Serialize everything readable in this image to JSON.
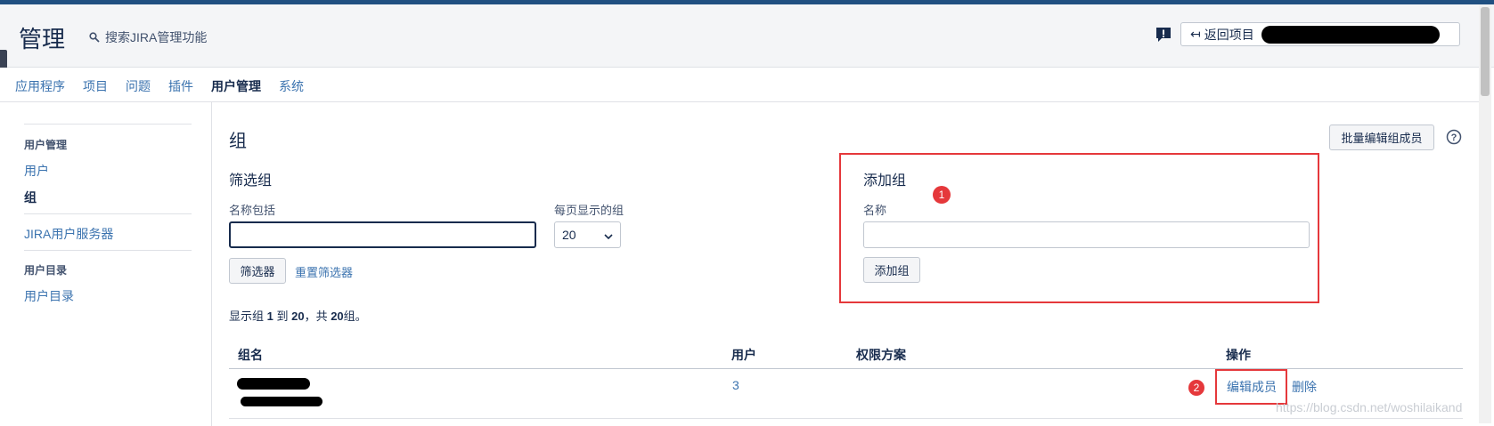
{
  "header": {
    "title": "管理",
    "search_label": "搜索JIRA管理功能",
    "back_label": "返回项目"
  },
  "nav": {
    "items": [
      {
        "label": "应用程序"
      },
      {
        "label": "项目"
      },
      {
        "label": "问题"
      },
      {
        "label": "插件"
      },
      {
        "label": "用户管理"
      },
      {
        "label": "系统"
      }
    ]
  },
  "sidebar": {
    "section1_heading": "用户管理",
    "link_users": "用户",
    "link_groups": "组",
    "link_jira_user_server": "JIRA用户服务器",
    "section2_heading": "用户目录",
    "link_user_directories": "用户目录"
  },
  "main": {
    "page_title": "组",
    "bulk_edit_button": "批量编辑组成员",
    "filter": {
      "title": "筛选组",
      "name_label": "名称包括",
      "name_value": "",
      "per_page_label": "每页显示的组",
      "per_page_value": "20",
      "filter_button": "筛选器",
      "reset_link": "重置筛选器"
    },
    "add_group": {
      "title": "添加组",
      "name_label": "名称",
      "name_value": "",
      "add_button": "添加组"
    },
    "results_prefix": "显示组 ",
    "results_from": "1",
    "results_to_word": " 到 ",
    "results_to": "20",
    "results_total_word": "，共 ",
    "results_total": "20",
    "results_suffix": "组。",
    "table": {
      "headers": [
        "组名",
        "用户",
        "权限方案",
        "操作"
      ],
      "rows": [
        {
          "users": "3",
          "edit_members": "编辑成员",
          "delete": "删除"
        }
      ]
    }
  },
  "annotations": {
    "marker1": "1",
    "marker2": "2"
  },
  "watermark": "https://blog.csdn.net/woshilaikand"
}
